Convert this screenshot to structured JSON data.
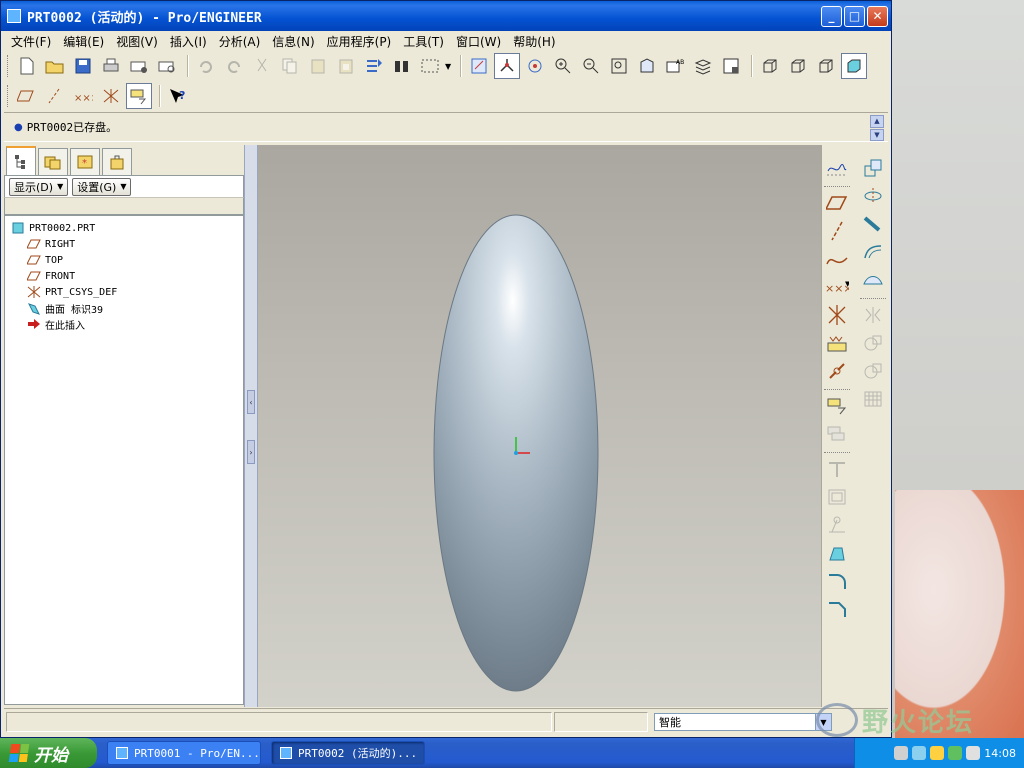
{
  "window": {
    "title": "PRT0002 (活动的) - Pro/ENGINEER",
    "buttons": {
      "minimize": "_",
      "maximize": "□",
      "close": "✕"
    }
  },
  "menubar": {
    "items": [
      "文件(F)",
      "编辑(E)",
      "视图(V)",
      "插入(I)",
      "分析(A)",
      "信息(N)",
      "应用程序(P)",
      "工具(T)",
      "窗口(W)",
      "帮助(H)"
    ]
  },
  "message": {
    "text": "PRT0002已存盘。"
  },
  "navigator": {
    "display_btn": "显示(D)",
    "settings_btn": "设置(G)",
    "tree": [
      {
        "label": "PRT0002.PRT",
        "icon": "part-icon",
        "level": 0
      },
      {
        "label": "RIGHT",
        "icon": "datum-plane-icon",
        "level": 1
      },
      {
        "label": "TOP",
        "icon": "datum-plane-icon",
        "level": 1
      },
      {
        "label": "FRONT",
        "icon": "datum-plane-icon",
        "level": 1
      },
      {
        "label": "PRT_CSYS_DEF",
        "icon": "csys-icon",
        "level": 1
      },
      {
        "label": "曲面 标识39",
        "icon": "surface-icon",
        "level": 1
      },
      {
        "label": "在此插入",
        "icon": "insert-here-arrow-icon",
        "level": 1
      }
    ]
  },
  "statusbar": {
    "filter": "智能"
  },
  "taskbar": {
    "start": "开始",
    "tasks": [
      {
        "label": "PRT0001 - Pro/EN...",
        "active": false
      },
      {
        "label": "PRT0002 (活动的)...",
        "active": true
      }
    ],
    "clock": "14:08"
  },
  "watermark": {
    "text": "野火论坛"
  },
  "colors": {
    "accent": "#0452d2",
    "viewport_top": "#a9a79f",
    "viewport_bottom": "#d3d2ca"
  }
}
